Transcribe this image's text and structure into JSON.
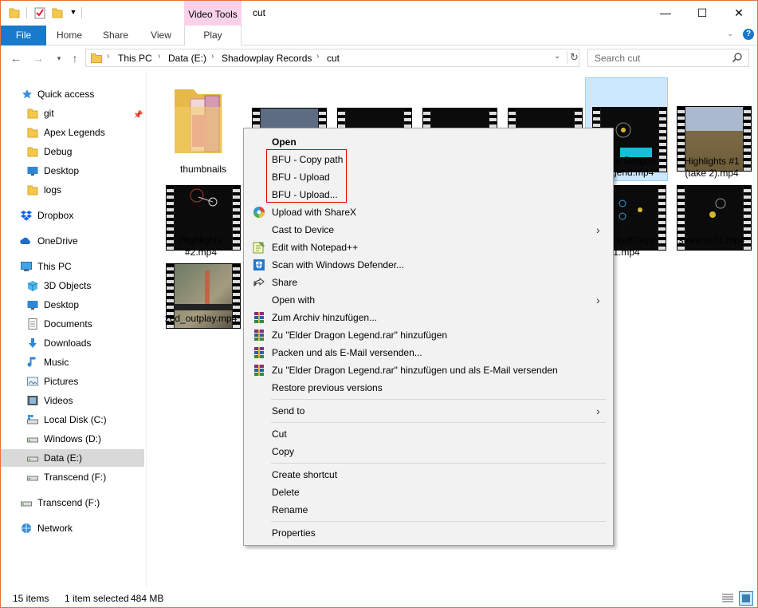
{
  "window": {
    "title": "cut",
    "contextual_tab_group": "Video Tools"
  },
  "ribbon": {
    "tabs": [
      "File",
      "Home",
      "Share",
      "View",
      "Play"
    ]
  },
  "address": {
    "breadcrumb": [
      "This PC",
      "Data (E:)",
      "Shadowplay Records",
      "cut"
    ],
    "search_placeholder": "Search cut"
  },
  "nav": {
    "quick_access": "Quick access",
    "quick_items": [
      "git",
      "Apex Legends",
      "Debug",
      "Desktop",
      "logs"
    ],
    "dropbox": "Dropbox",
    "onedrive": "OneDrive",
    "this_pc": "This PC",
    "pc_items": [
      "3D Objects",
      "Desktop",
      "Documents",
      "Downloads",
      "Music",
      "Pictures",
      "Videos",
      "Local Disk (C:)",
      "Windows (D:)",
      "Data (E:)",
      "Transcend (F:)"
    ],
    "transcend": "Transcend (F:)",
    "network": "Network"
  },
  "files": [
    {
      "name": "thumbnails"
    },
    {
      "name": "Elder Dragon Legend.mp4",
      "label_lines": [
        "Elder Dragon",
        "Legend.mp4"
      ]
    },
    {
      "name": "Highlights #1 (take 2).mp4",
      "label_lines": [
        "Highlights #1",
        "(take 2).mp4"
      ]
    },
    {
      "name": "Highlights #2.mp4",
      "label_lines": [
        "Highlights",
        "#2.mp4"
      ]
    },
    {
      "name": "TrackedDay#1.mp4",
      "label_lines": [
        "TrackedDay#",
        "1.mp4"
      ]
    },
    {
      "name": "streams#1.mp4"
    },
    {
      "name": "zed_outplay.mp4"
    }
  ],
  "context_menu": {
    "open": "Open",
    "bfu_copy_path": "BFU - Copy path",
    "bfu_upload": "BFU - Upload",
    "bfu_upload_dots": "BFU - Upload...",
    "upload_sharex": "Upload with ShareX",
    "cast": "Cast to Device",
    "notepad": "Edit with Notepad++",
    "defender": "Scan with Windows Defender...",
    "share": "Share",
    "open_with": "Open with",
    "zum_archiv": "Zum Archiv hinzufügen...",
    "zu_rar": "Zu \"Elder Dragon Legend.rar\" hinzufügen",
    "packen": "Packen und als E-Mail versenden...",
    "zu_rar_mail": "Zu \"Elder Dragon Legend.rar\" hinzufügen und als E-Mail versenden",
    "restore": "Restore previous versions",
    "send_to": "Send to",
    "cut": "Cut",
    "copy": "Copy",
    "create_shortcut": "Create shortcut",
    "delete": "Delete",
    "rename": "Rename",
    "properties": "Properties"
  },
  "status": {
    "items": "15 items",
    "selected": "1 item selected",
    "size": "484 MB"
  },
  "colors": {
    "accent": "#1979ca",
    "selection": "#cce8ff",
    "context_tab": "#f9d2e9",
    "window_border": "#e7703a",
    "highlight_box": "#e00000"
  }
}
